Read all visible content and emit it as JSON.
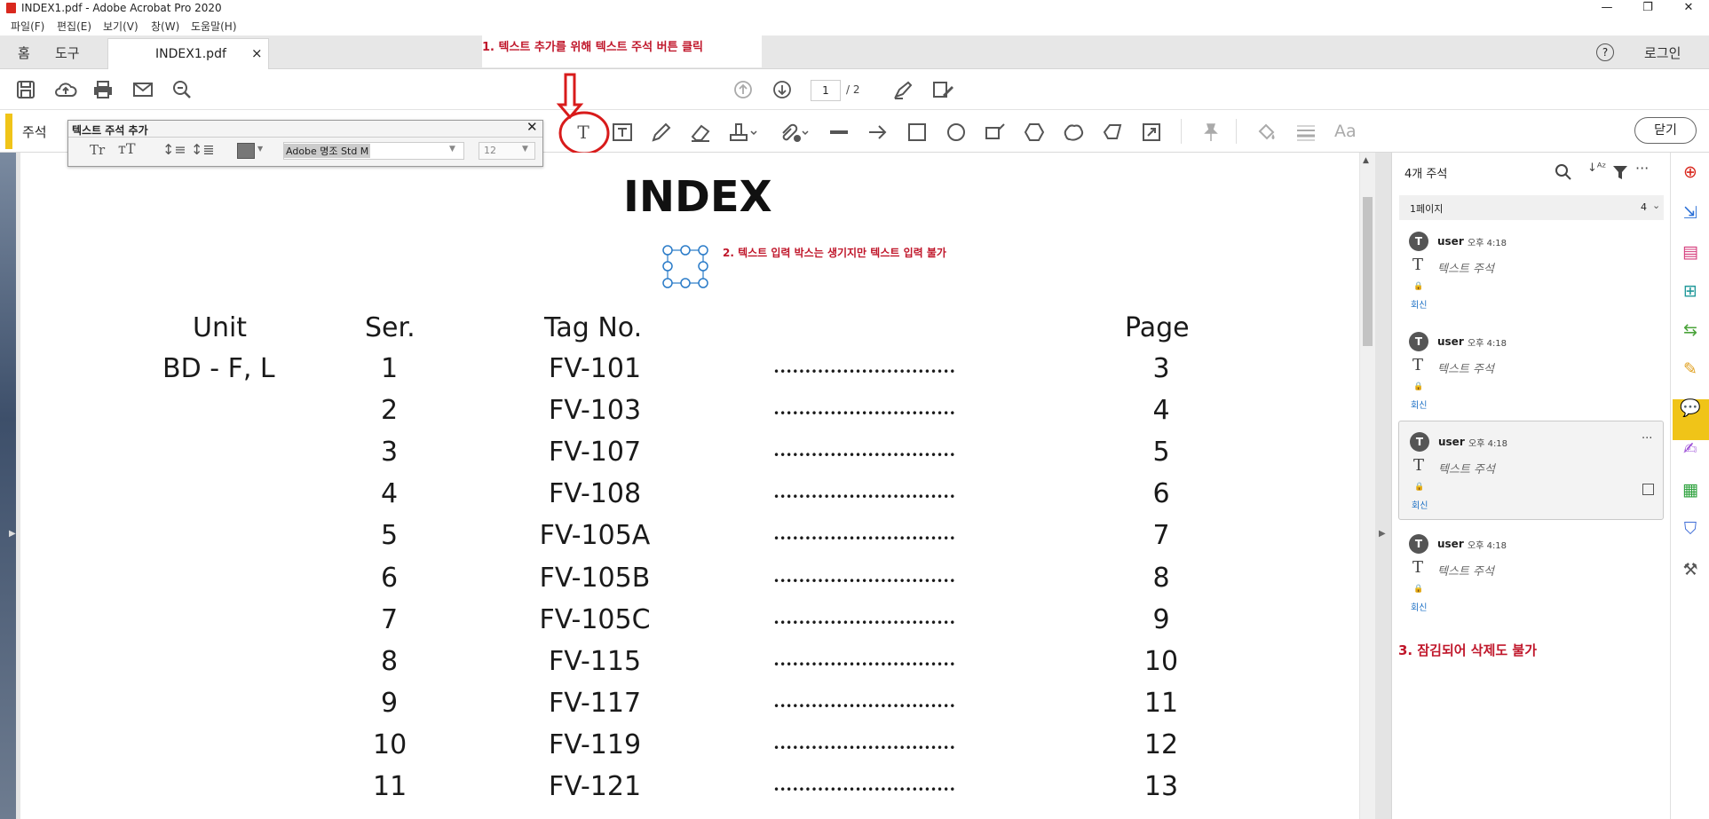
{
  "window": {
    "title": "INDEX1.pdf - Adobe Acrobat Pro 2020",
    "minimize": "—",
    "restore": "❐",
    "close": "✕"
  },
  "menu": [
    "파일(F)",
    "편집(E)",
    "보기(V)",
    "창(W)",
    "도움말(H)"
  ],
  "tabs": {
    "home": "홈",
    "tools": "도구",
    "file": "INDEX1.pdf",
    "file_close": "×",
    "help": "?",
    "login": "로그인"
  },
  "toolbar": {
    "page_current": "1",
    "page_total": "/ 2"
  },
  "comment_toolbar": {
    "label": "주석",
    "close": "닫기",
    "font_size_label": "Aa"
  },
  "text_props": {
    "title": "텍스트 주석 추가",
    "font": "Adobe 명조 Std M",
    "size": "12",
    "close": "✕"
  },
  "annotations": {
    "step1": "1. 텍스트 추가를 위해 텍스트 주석 버튼 클릭",
    "step2": "2. 텍스트 입력 박스는 생기지만 텍스트 입력 불가",
    "step3": "3. 잠김되어 삭제도 불가",
    "arrow_color": "#d81b1b"
  },
  "document": {
    "title": "INDEX",
    "headers": [
      "Unit",
      "Ser.",
      "Tag No.",
      "Page"
    ],
    "rows": [
      {
        "unit": "BD - F, L",
        "ser": "1",
        "tag": "FV-101",
        "dots": "•••••••••••••••••••••••••••••",
        "page": "3"
      },
      {
        "unit": "",
        "ser": "2",
        "tag": "FV-103",
        "dots": "•••••••••••••••••••••••••••••",
        "page": "4"
      },
      {
        "unit": "",
        "ser": "3",
        "tag": "FV-107",
        "dots": "•••••••••••••••••••••••••••••",
        "page": "5"
      },
      {
        "unit": "",
        "ser": "4",
        "tag": "FV-108",
        "dots": "•••••••••••••••••••••••••••••",
        "page": "6"
      },
      {
        "unit": "",
        "ser": "5",
        "tag": "FV-105A",
        "dots": "•••••••••••••••••••••••••••••",
        "page": "7"
      },
      {
        "unit": "",
        "ser": "6",
        "tag": "FV-105B",
        "dots": "•••••••••••••••••••••••••••••",
        "page": "8"
      },
      {
        "unit": "",
        "ser": "7",
        "tag": "FV-105C",
        "dots": "•••••••••••••••••••••••••••••",
        "page": "9"
      },
      {
        "unit": "",
        "ser": "8",
        "tag": "FV-115",
        "dots": "•••••••••••••••••••••••••••••",
        "page": "10"
      },
      {
        "unit": "",
        "ser": "9",
        "tag": "FV-117",
        "dots": "•••••••••••••••••••••••••••••",
        "page": "11"
      },
      {
        "unit": "",
        "ser": "10",
        "tag": "FV-119",
        "dots": "•••••••••••••••••••••••••••••",
        "page": "12"
      },
      {
        "unit": "",
        "ser": "11",
        "tag": "FV-121",
        "dots": "•••••••••••••••••••••••••••••",
        "page": "13"
      }
    ]
  },
  "comments_pane": {
    "header": "4개 주석",
    "page_group": "1페이지",
    "page_group_count": "4",
    "items": [
      {
        "user": "user",
        "time": "오후 4:18",
        "type": "텍스트 주석",
        "reply": "회신",
        "avatar": "T"
      },
      {
        "user": "user",
        "time": "오후 4:18",
        "type": "텍스트 주석",
        "reply": "회신",
        "avatar": "T"
      },
      {
        "user": "user",
        "time": "오후 4:18",
        "type": "텍스트 주석",
        "reply": "회신",
        "avatar": "T",
        "more": "···"
      },
      {
        "user": "user",
        "time": "오후 4:18",
        "type": "텍스트 주석",
        "reply": "회신",
        "avatar": "T"
      }
    ]
  },
  "colors": {
    "accent_yellow": "#f0c418",
    "annotation_red": "#c0172b",
    "link_blue": "#1b6fc4"
  }
}
